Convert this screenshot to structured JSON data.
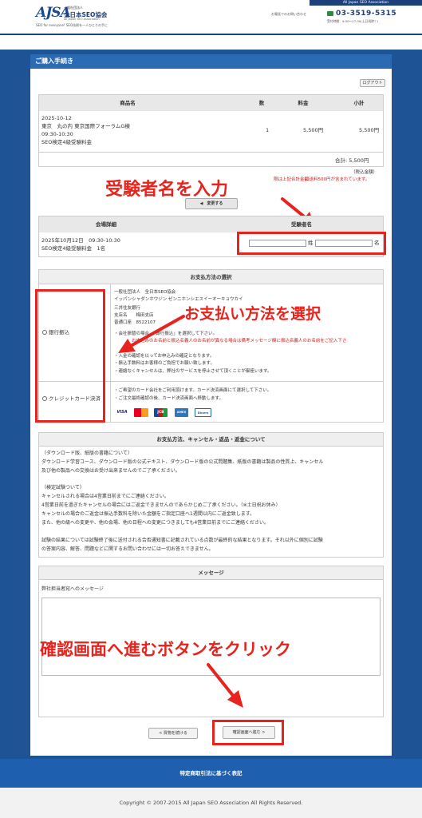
{
  "header": {
    "logo_mark": "AJSA",
    "logo_small": "一般社団法人",
    "logo_name": "全日本SEO協会",
    "logo_en": "All Japan SEO Association",
    "tagline": "SEO for everyone! SEO技術を一人ひとりの手に",
    "assoc_bar": "All Japan SEO Association",
    "contact_label": "お電話でのお問い合わせ",
    "phone": "03-3519-5315",
    "hours": "受付時間：9:30～17:30(土日祝除く)"
  },
  "page_title": "ご購入手続き",
  "logout_label": "ログアウト",
  "order": {
    "headers": [
      "商品名",
      "数",
      "料金",
      "小計"
    ],
    "row": {
      "product_lines": [
        "2025-10-12",
        "東京　丸の内 東京国際フォーラムG棟",
        "09:30-10:30",
        "SEO検定4級受験料金"
      ],
      "qty": "1",
      "price": "5,500円",
      "subtotal": "5,500円"
    },
    "total": "合計: 5,500円",
    "tax_note": "（税込金額）",
    "shipping_note": "に送料500円が含まれています。",
    "shipping_note_a": "限は上記合計金額",
    "change_button": "◀　変更する"
  },
  "examinee": {
    "headers": [
      "会場詳細",
      "受験者名"
    ],
    "venue": "2025年10月12日　09:30-10:30",
    "venue2": "SEO検定4級受験料金　1名",
    "sei_label": "姓",
    "mei_label": "名"
  },
  "payment": {
    "header": "お支払方法の選択",
    "bank_label": "銀行振込",
    "card_label": "クレジットカード決済",
    "bank_lines": [
      "一般社団法人　全日本SEO協会",
      "イッパンシャダンホウジン ゼンニホンシエスイーオーキョウカイ",
      "三井住友銀行",
      "支店名　　梅田支店",
      "普通口座　8522107"
    ],
    "bank_notes": [
      "・会社振替の場合、「銀行振込」を選択して下さい。",
      "・入金の確認を以ってお申込みの確定となります。",
      "・振込手数料はお客様のご負担でお願い致します。",
      "・連絡なくキャンセルは、弊社のサービスを停止させて頂くことが御座います。"
    ],
    "bank_red_note": "お申込みのお名前と振込名義人のお名前が異なる場合は備考メッセージ欄に振込名義人のお名前をご記入下さ",
    "card_notes": [
      "・ご希望のカード会社をご利用頂けます。カード決済画面にて選択して下さい。",
      "・ご注文最終確認の後、カード決済画面へ移動します。"
    ],
    "cards": [
      "VISA",
      "MC",
      "JCB",
      "AMEX",
      "Diners"
    ]
  },
  "policy": {
    "header": "お支払方法、キャンセル・返品・返金について",
    "lines": [
      "（ダウンロード版、紙版の書籍について）",
      "ダウンロード学習コース、ダウンロード版の公式テキスト、ダウンロード版の公式問題集、紙版の書籍は製品の性質上、キャンセル",
      "及び他の製品への交換はお受け出来ませんのでご了承ください。",
      "",
      "（検定試験ついて）",
      "キャンセルされる場合は4営業日前までにご連絡ください。",
      "4営業日前を過ぎたキャンセルの場合にはご返金できませんのであらかじめご了承ください。（※土日祝お休み）",
      "キャンセルの場合のご返金は振込手数料を除いた金額をご指定口座へ1週間以内にご返金致します。",
      "また、他の級への変更や、他の会場、他の日程への変更につきましても4営業日前までにご連絡ください。",
      "",
      "試験の結果については試験終了後に送付される合否通知書に記載されている点数が最終的な結果となります。それ以外に個別に試験",
      "の答案内容、解答、問題などに関するお問い合わせには一切お答えできません。"
    ]
  },
  "message": {
    "header": "メッセージ",
    "label": "弊社担当者宛へのメッセージ",
    "value": ""
  },
  "buttons": {
    "continue": "< 買物を続ける",
    "confirm": "確認画面へ進む >"
  },
  "annotations": {
    "a1": "受験者名を入力",
    "a2": "お支払い方法を選択",
    "a3": "確認画面へ進むボタンをクリック"
  },
  "footer": {
    "link": "特定商取引法に基づく表記",
    "copyright": "Copyright © 2007-2015 All Japan SEO Association All Rights Reserved."
  },
  "colors": {
    "brand": "#1d3f7a",
    "accent_red": "#e8231d",
    "title_blue": "#2b6bb3"
  }
}
